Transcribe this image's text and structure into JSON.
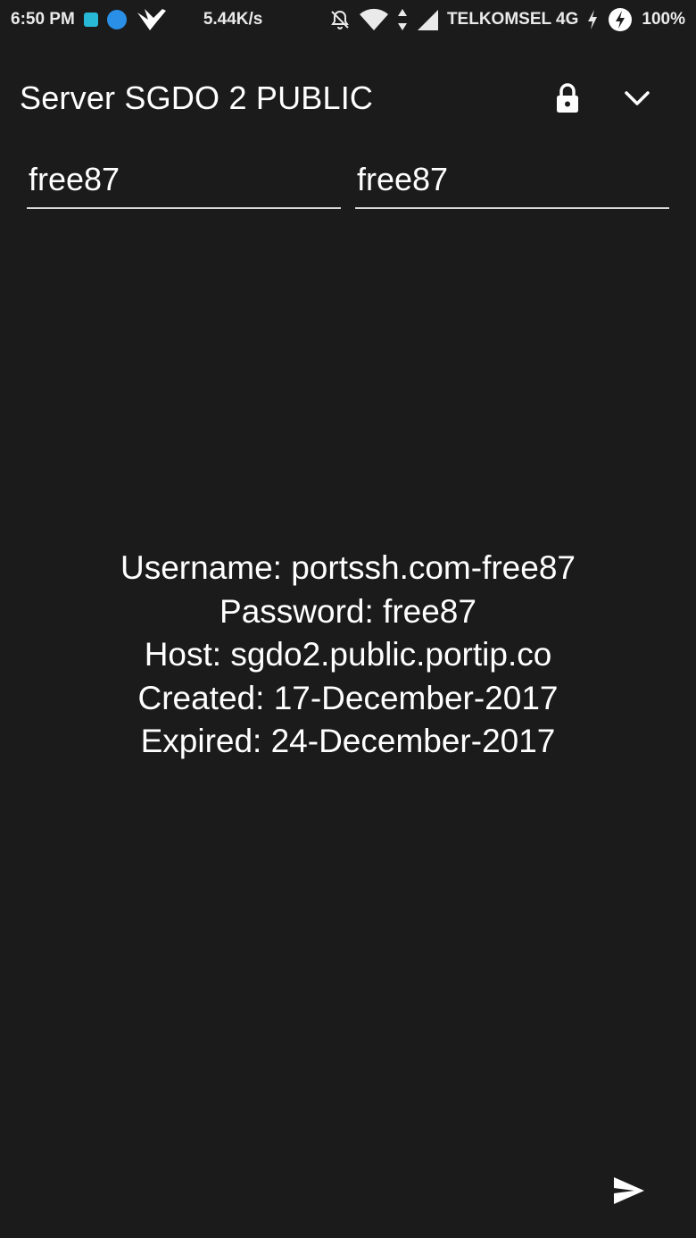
{
  "status_bar": {
    "time": "6:50 PM",
    "speed": "5.44K/s",
    "carrier": "TELKOMSEL 4G",
    "battery": "100%"
  },
  "app_bar": {
    "title": "Server SGDO 2 PUBLIC"
  },
  "fields": {
    "username_value": "free87",
    "password_value": "free87"
  },
  "info": {
    "username_line": "Username: portssh.com-free87",
    "password_line": "Password: free87",
    "host_line": "Host: sgdo2.public.portip.co",
    "created_line": "Created: 17-December-2017",
    "expired_line": "Expired: 24-December-2017"
  },
  "icons": {
    "lock": "lock-icon",
    "chevron": "chevron-down-icon",
    "send": "send-icon"
  }
}
